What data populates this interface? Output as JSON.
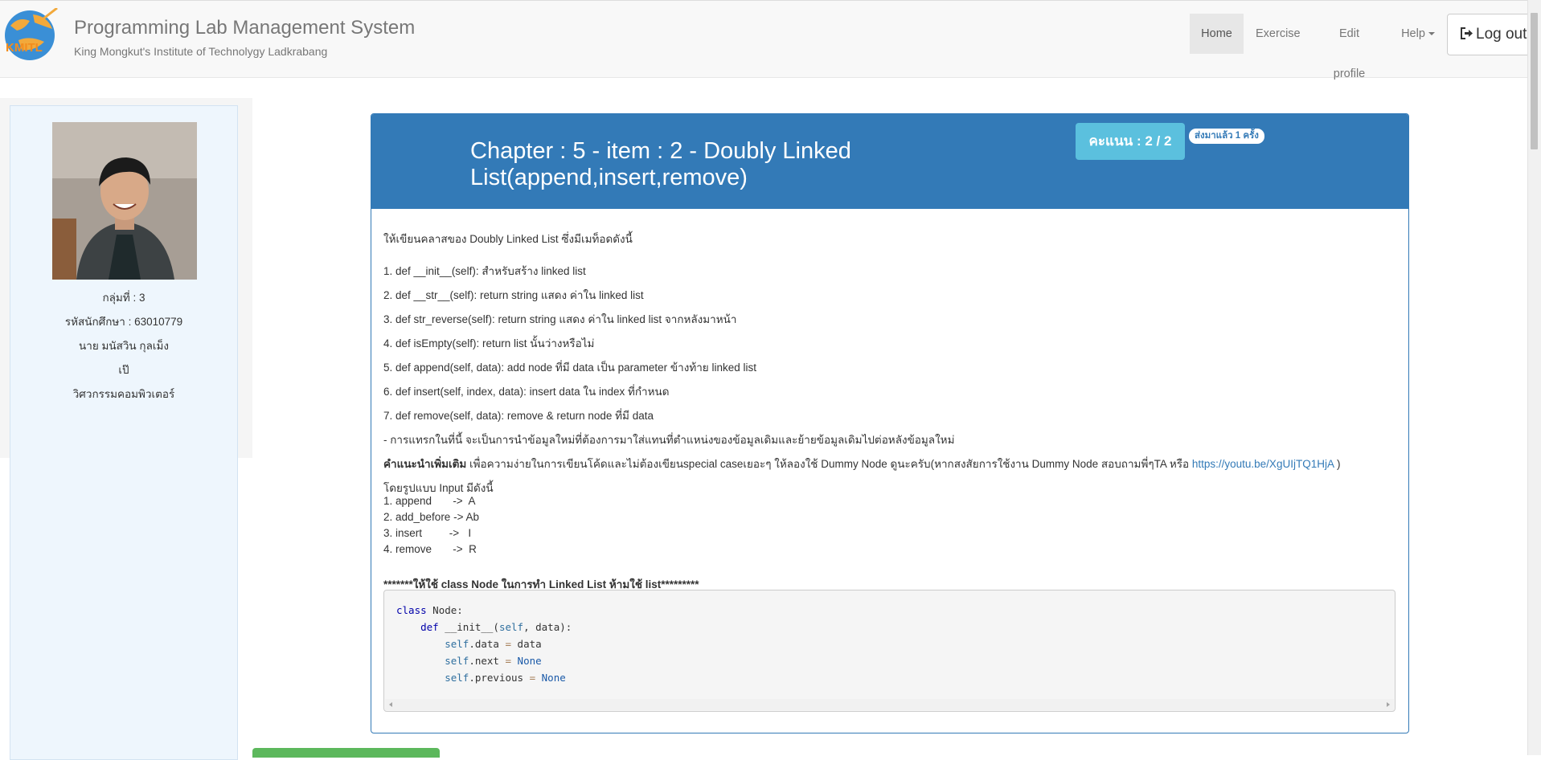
{
  "header": {
    "title": "Programming Lab Management System",
    "subtitle": "King Mongkut's Institute of Technolygy Ladkrabang",
    "logo_text": "KMITL",
    "nav": [
      {
        "label": "Home"
      },
      {
        "label": "Exercise"
      },
      {
        "label": "Edit profile"
      },
      {
        "label": "Help"
      }
    ],
    "logout_label": "Log out"
  },
  "student": {
    "group": "กลุ่มที่ : 3",
    "student_id": "รหัสนักศึกษา : 63010779",
    "name": "นาย มนัสวิน กุลเม็ง",
    "nickname": "เป๊",
    "faculty": "วิศวกรรมคอมพิวเตอร์"
  },
  "exercise": {
    "title": "Chapter : 5 - item : 2 - Doubly Linked List(append,insert,remove)",
    "score": "คะแนน : 2 / 2",
    "submitted": "ส่งมาแล้ว 1 ครั้ง",
    "intro": "ให้เขียนคลาสของ Doubly Linked List ซึ่งมีเมท็อดดังนี้",
    "methods": [
      "1. def __init__(self): สำหรับสร้าง linked list",
      "2. def __str__(self): return string แสดง ค่าใน linked list",
      "3. def str_reverse(self): return string แสดง ค่าใน linked list จากหลังมาหน้า",
      "4. def isEmpty(self): return list นั้นว่างหรือไม่",
      "5. def append(self, data): add node ที่มี data เป็น parameter ข้างท้าย linked list",
      "6. def insert(self, index, data): insert data ใน index ที่กำหนด",
      "7. def remove(self, data): remove & return node ที่มี data"
    ],
    "insert_note": " - การแทรกในที่นี้ จะเป็นการนำข้อมูลใหม่ที่ต้องการมาใส่แทนที่ตำแหน่งของข้อมูลเดิมและย้ายข้อมูลเดิมไปต่อหลังข้อมูลใหม่",
    "tip_label": "คำแนะนำเพิ่มเติม",
    "tip_text": " เพื่อความง่ายในการเขียนโค้ดและไม่ต้องเขียนspecial caseเยอะๆ ให้ลองใช้ Dummy Node ดูนะครับ(หากสงสัยการใช้งาน Dummy Node สอบถามพี่ๆTA หรือ ",
    "tip_link": "https://youtu.be/XgUIjTQ1HjA",
    "tip_end": " )",
    "input_heading": "โดยรูปแบบ Input มีดังนี้",
    "input_formats": [
      "1. append       ->  A",
      "2. add_before -> Ab",
      "3. insert         ->   I",
      "4. remove       ->  R"
    ],
    "warning_prefix": "*******",
    "warning_bold": "ให้ใช้ class Node ในการทำ Linked List ห้ามใช้ list",
    "warning_suffix": "*********",
    "code": {
      "l1_kw": "class",
      "l1_rest": " Node:",
      "l2_kw": "def",
      "l2_rest": " __init__(",
      "l2_self": "self",
      "l2_end": ", data):",
      "self": "self",
      "eq": "=",
      "l3_attr": ".data ",
      "l3_val": " data",
      "l4_attr": ".next ",
      "l4_val": "None",
      "l5_attr": ".previous ",
      "l5_val": "None"
    }
  }
}
